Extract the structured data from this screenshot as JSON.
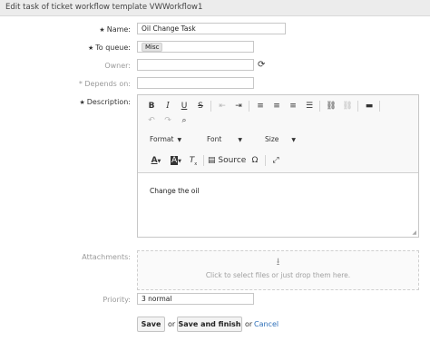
{
  "header": {
    "title": "Edit task of ticket workflow template VWWorkflow1"
  },
  "form": {
    "name": {
      "label": "Name:",
      "value": "Oil Change Task",
      "required": true
    },
    "queue": {
      "label": "To queue:",
      "value": "Misc",
      "required": true
    },
    "owner": {
      "label": "Owner:",
      "value": ""
    },
    "depends_on": {
      "label": "* Depends on:",
      "value": ""
    },
    "description": {
      "label": "Description:",
      "required": true,
      "content": "Change the oil",
      "toolbar": {
        "format_label": "Format",
        "font_label": "Font",
        "size_label": "Size",
        "source_label": "Source",
        "buttons": [
          "bold",
          "italic",
          "underline",
          "strikethrough",
          "outdent",
          "indent",
          "align-left",
          "align-center",
          "align-right",
          "align-justify",
          "link",
          "unlink",
          "horizontal-line",
          "undo",
          "redo",
          "find",
          "text-color",
          "background-color",
          "remove-format",
          "source",
          "special-char",
          "maximize"
        ]
      }
    },
    "attachments": {
      "label": "Attachments:",
      "hint": "Click to select files or just drop them here."
    },
    "priority": {
      "label": "Priority:",
      "value": "3 normal"
    }
  },
  "actions": {
    "save": "Save",
    "or1": "or",
    "save_finish": "Save and finish",
    "or2": "or",
    "cancel": "Cancel"
  }
}
